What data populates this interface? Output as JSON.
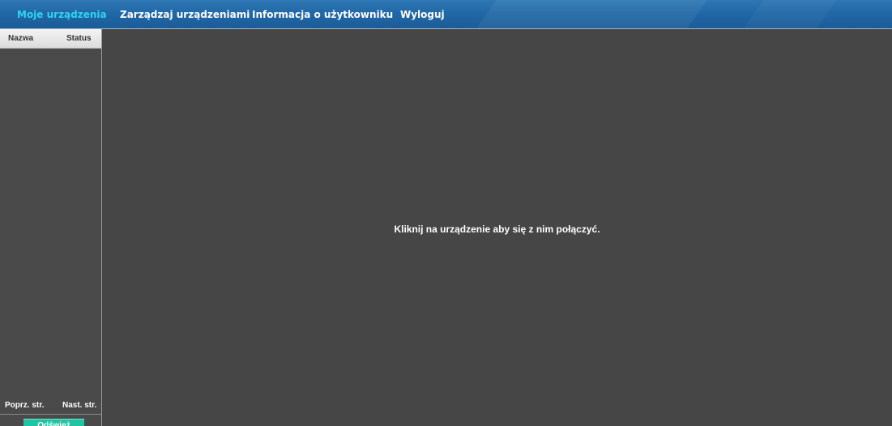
{
  "nav": {
    "items": [
      {
        "label": "Moje urządzenia"
      },
      {
        "label": "Zarządzaj urządzeniami"
      },
      {
        "label": "Informacja o użytkowniku"
      },
      {
        "label": "Wyloguj"
      }
    ],
    "active_color": "#2fd4ee",
    "bar_color": "#2168a7"
  },
  "device_list": {
    "columns": [
      "Nazwa",
      "Status"
    ],
    "rows": [],
    "prev_label": "Poprz. str.",
    "next_label": "Nast. str.",
    "refresh_label": "Odśwież",
    "refresh_color": "#1fc4a3"
  },
  "viewer": {
    "message": "Kliknij na urządzenie aby się z nim połączyć.",
    "background": "#464646"
  }
}
